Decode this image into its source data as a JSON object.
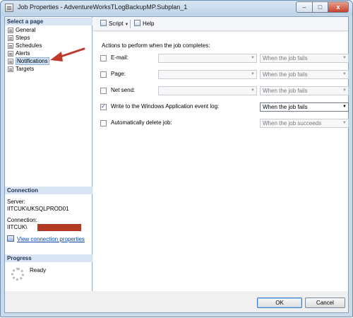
{
  "window": {
    "title": "Job Properties - AdventureWorksTLogBackupMP.Subplan_1",
    "min_glyph": "–",
    "max_glyph": "□",
    "close_glyph": "x"
  },
  "select_page": {
    "header": "Select a page",
    "items": [
      {
        "label": "General"
      },
      {
        "label": "Steps"
      },
      {
        "label": "Schedules"
      },
      {
        "label": "Alerts"
      },
      {
        "label": "Notifications",
        "selected": true
      },
      {
        "label": "Targets"
      }
    ]
  },
  "connection": {
    "header": "Connection",
    "server_label": "Server:",
    "server_value": "IITCUK\\UKSQLPROD01",
    "connection_label": "Connection:",
    "connection_value": "IITCUK\\",
    "link": "View connection properties"
  },
  "progress": {
    "header": "Progress",
    "status": "Ready"
  },
  "toolbar": {
    "script_label": "Script",
    "help_label": "Help"
  },
  "notifications": {
    "title": "Actions to perform when the job completes:",
    "rows": [
      {
        "label": "E-mail:",
        "checked": false,
        "combo1": "",
        "combo2": "When the job fails",
        "enabled": false
      },
      {
        "label": "Page:",
        "checked": false,
        "combo1": "",
        "combo2": "When the job fails",
        "enabled": false
      },
      {
        "label": "Net send:",
        "checked": false,
        "combo1": "",
        "combo2": "When the job fails",
        "enabled": false
      },
      {
        "label": "Write to the Windows Application event log:",
        "checked": true,
        "combo2": "When the job fails",
        "enabled": true
      },
      {
        "label": "Automatically delete job:",
        "checked": false,
        "combo2": "When the job succeeds",
        "enabled": false
      }
    ]
  },
  "buttons": {
    "ok": "OK",
    "cancel": "Cancel"
  },
  "colors": {
    "annotation_arrow": "#c0392b",
    "redaction": "#b23a25"
  }
}
